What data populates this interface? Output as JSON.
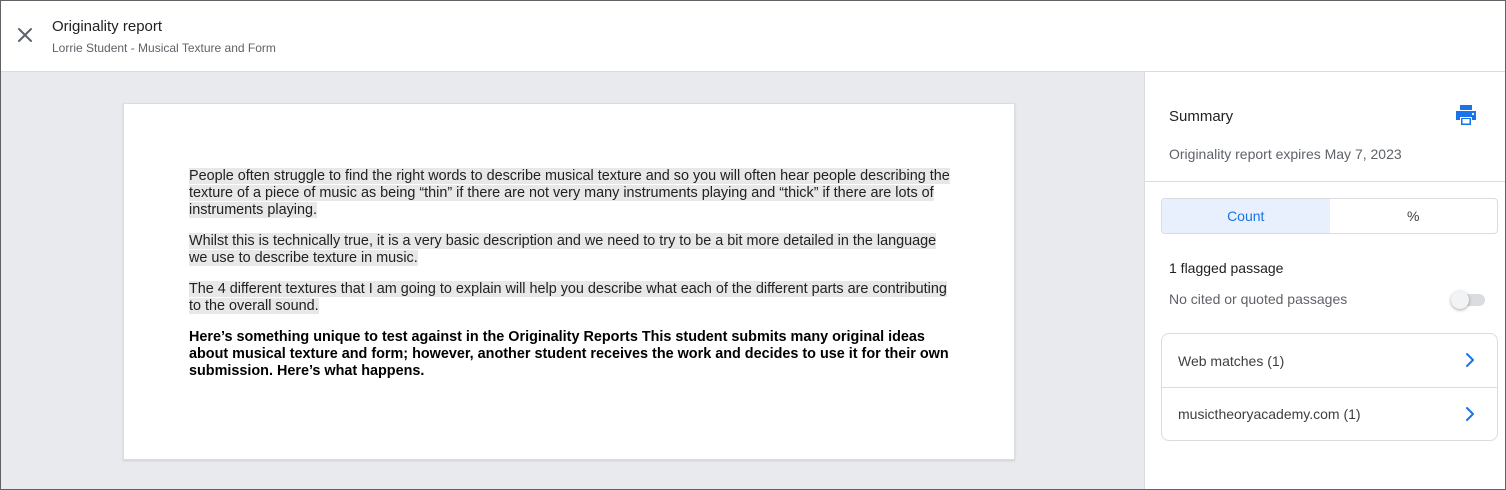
{
  "header": {
    "title": "Originality report",
    "subtitle": "Lorrie Student - Musical Texture and Form",
    "close_icon": "close-icon"
  },
  "document": {
    "paragraphs": [
      {
        "text": "People often struggle to find the right words to describe musical texture and so you will often hear people describing the texture of a piece of music as being “thin” if there are not very many instruments playing and “thick” if there are lots of instruments playing.",
        "flagged": true
      },
      {
        "text": "Whilst this is technically true, it is a very basic description and we need to try to be a bit more detailed in the language we use to describe texture in music.",
        "flagged": true
      },
      {
        "text": "The 4 different textures that I am going to explain will help you describe what each of the different parts are contributing to the overall sound.",
        "flagged": true
      },
      {
        "text": "Here’s something unique to test against in the Originality Reports This student submits many original ideas about musical texture and form; however, another student receives the work and decides to use it for their own submission. Here’s what happens.",
        "flagged": false,
        "bold": true
      }
    ]
  },
  "summary": {
    "title": "Summary",
    "print_icon": "print-icon",
    "expires": "Originality report expires May 7, 2023",
    "tabs": [
      {
        "label": "Count",
        "active": true
      },
      {
        "label": "%",
        "active": false
      }
    ],
    "flagged": "1 flagged passage",
    "cited_label": "No cited or quoted passages",
    "cited_toggle_on": false,
    "matches": [
      {
        "label": "Web matches (1)"
      },
      {
        "label": "musictheoryacademy.com (1)"
      }
    ]
  },
  "colors": {
    "accent": "#1a73e8",
    "active_tab_bg": "#e8f0fe",
    "highlight": "#e8e8e8",
    "canvas": "#e8eaed"
  }
}
